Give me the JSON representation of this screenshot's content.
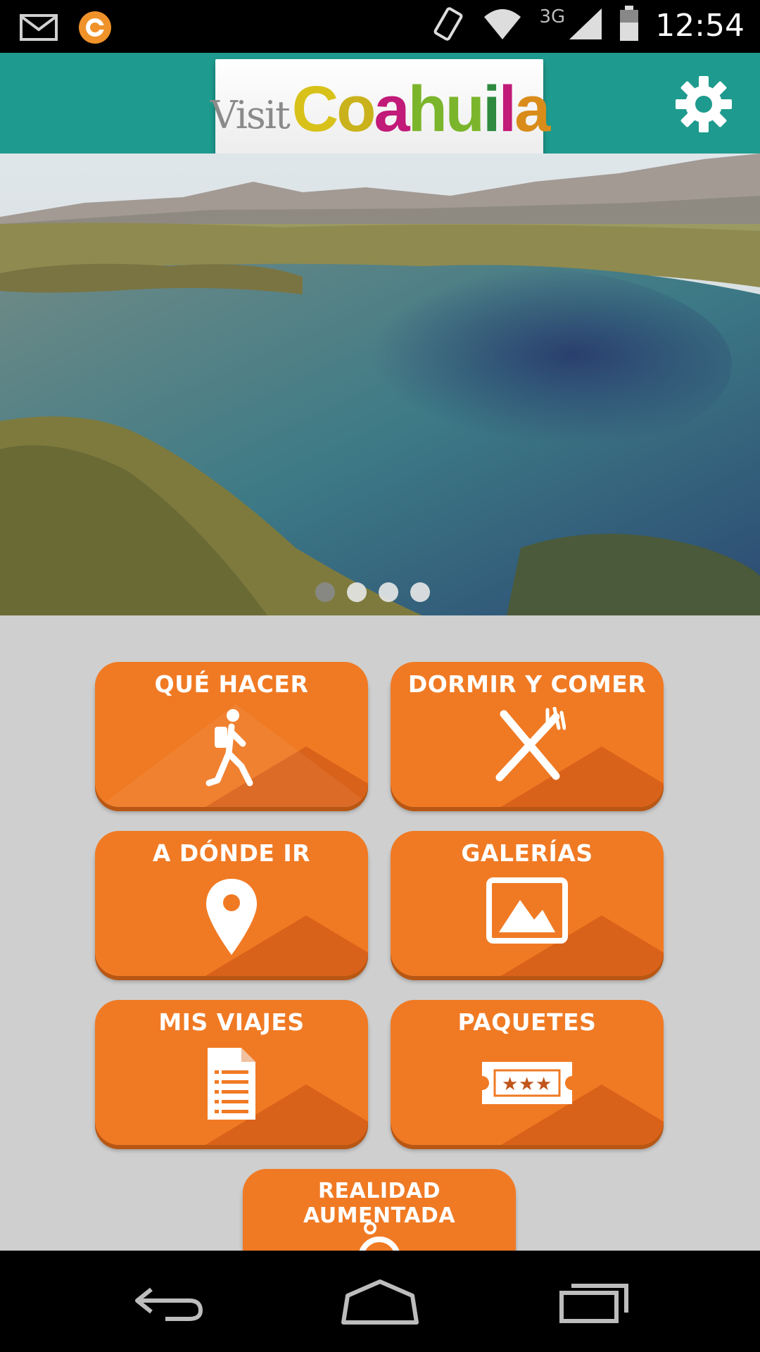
{
  "status_bar": {
    "time": "12:54",
    "network": "3G",
    "icons": [
      "mail-icon",
      "app-notification-icon",
      "vibrate-icon",
      "wifi-icon",
      "signal-icon",
      "battery-icon"
    ]
  },
  "header": {
    "logo_visit": "Visit",
    "logo_brand": "Coahuila",
    "logo_letter_colors": [
      "#d8c21a",
      "#c9b21c",
      "#c11a78",
      "#7bb52b",
      "#7bb52b",
      "#2e8a3e",
      "#c11a78",
      "#d98c1a"
    ],
    "bar_color": "#1e9b8e",
    "settings_icon": "gear-icon"
  },
  "carousel": {
    "slide_count": 4,
    "active_index": 0
  },
  "menu": {
    "tile_color": "#f07a24",
    "items": [
      {
        "label": "QUÉ HACER",
        "icon": "hiker-icon"
      },
      {
        "label": "DORMIR Y COMER",
        "icon": "knife-fork-icon"
      },
      {
        "label": "A DÓNDE IR",
        "icon": "map-pin-icon"
      },
      {
        "label": "GALERÍAS",
        "icon": "picture-icon"
      },
      {
        "label": "MIS VIAJES",
        "icon": "document-icon"
      },
      {
        "label": "PAQUETES",
        "icon": "ticket-icon"
      },
      {
        "label": "REALIDAD AUMENTADA",
        "icon": "ar-icon"
      }
    ]
  },
  "nav_bar": {
    "buttons": [
      "back-icon",
      "home-icon",
      "recents-icon"
    ]
  }
}
